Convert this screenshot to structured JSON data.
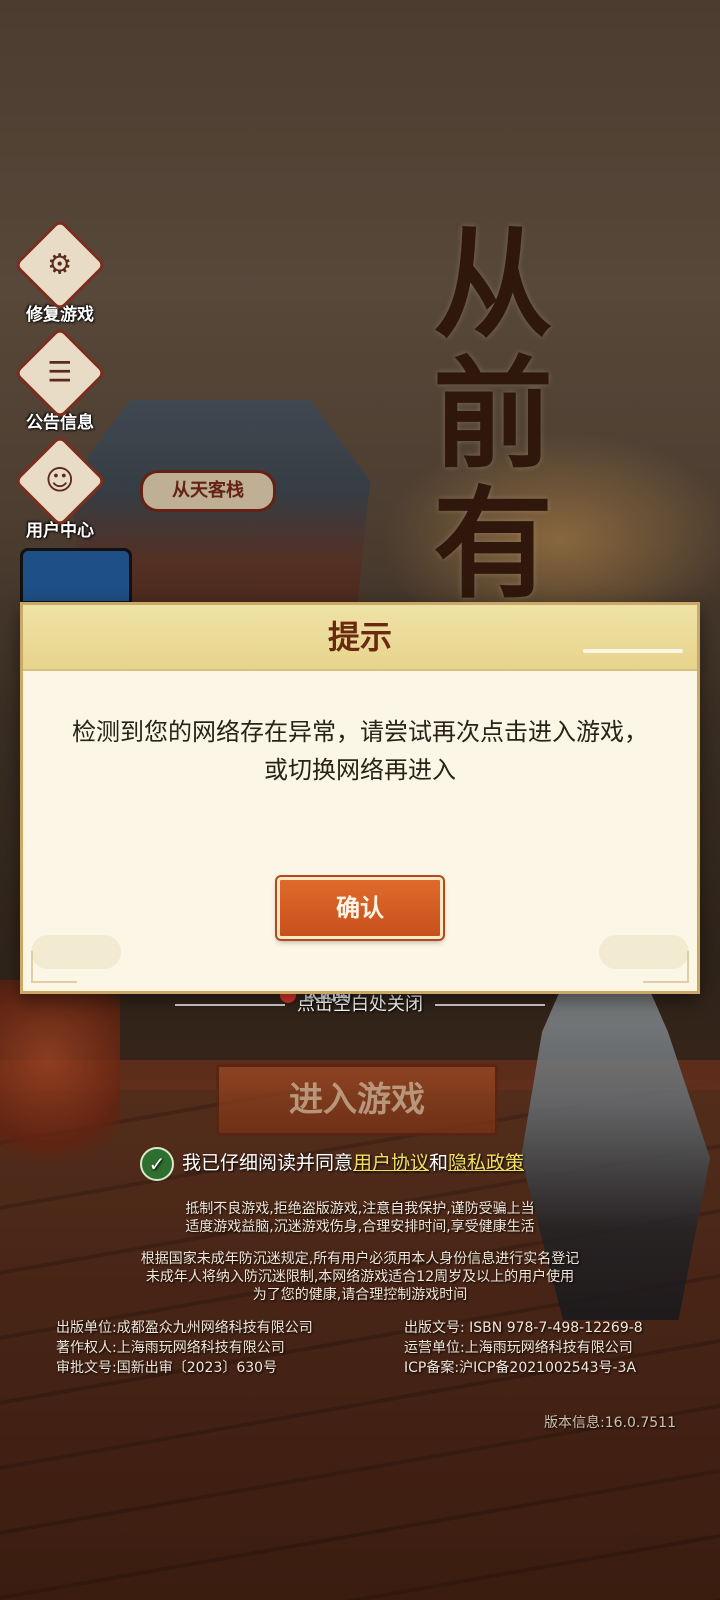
{
  "side_menu": [
    {
      "label": "修复游戏",
      "icon": "magnifier-gear-icon",
      "glyph": "⚙"
    },
    {
      "label": "公告信息",
      "icon": "bulletin-icon",
      "glyph": "☰"
    },
    {
      "label": "用户中心",
      "icon": "user-face-icon",
      "glyph": "☺"
    }
  ],
  "title_art": "从前有条",
  "inn_sign": "从天客栈",
  "street_sign": "太阳街",
  "dialog": {
    "title": "提示",
    "message_line1": "检测到您的网络存在异常，请尝试再次点击进入游戏，",
    "message_line2": "或切换网络再进入",
    "confirm_label": "确认"
  },
  "close_hint": "点击空白处关闭",
  "enter_game_label": "进入游戏",
  "agreement": {
    "prefix": "我已仔细阅读并同意",
    "user_agreement": "用户协议",
    "and": "和",
    "privacy_policy": "隐私政策"
  },
  "health_notice": {
    "line1": "抵制不良游戏,拒绝盗版游戏,注意自我保护,谨防受骗上当",
    "line2": "适度游戏益脑,沉迷游戏伤身,合理安排时间,享受健康生活"
  },
  "anti_addiction": {
    "line1": "根据国家未成年防沉迷规定,所有用户必须用本人身份信息进行实名登记",
    "line2": "未成年人将纳入防沉迷限制,本网络游戏适合12周岁及以上的用户使用",
    "line3": "为了您的健康,请合理控制游戏时间"
  },
  "publisher": {
    "publish_unit": "出版单位:成都盈众九州网络科技有限公司",
    "copyright_holder": "著作权人:上海雨玩网络科技有限公司",
    "approval_no": "审批文号:国新出审〔2023〕630号",
    "publish_no": "出版文号: ISBN 978-7-498-12269-8",
    "operator": "运营单位:上海雨玩网络科技有限公司",
    "icp": "ICP备案:沪ICP备2021002543号-3A"
  },
  "version": "版本信息:16.0.7511"
}
